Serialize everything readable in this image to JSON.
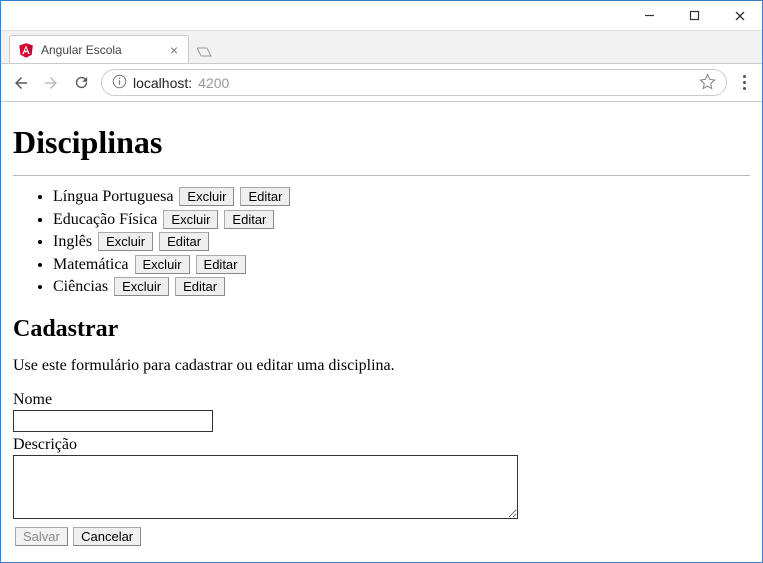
{
  "window": {
    "tab_title": "Angular Escola",
    "url_host": "localhost:",
    "url_port": "4200"
  },
  "page": {
    "heading": "Disciplinas",
    "items": [
      {
        "name": "Língua Portuguesa",
        "delete": "Excluir",
        "edit": "Editar"
      },
      {
        "name": "Educação Física",
        "delete": "Excluir",
        "edit": "Editar"
      },
      {
        "name": "Inglês",
        "delete": "Excluir",
        "edit": "Editar"
      },
      {
        "name": "Matemática",
        "delete": "Excluir",
        "edit": "Editar"
      },
      {
        "name": "Ciências",
        "delete": "Excluir",
        "edit": "Editar"
      }
    ],
    "form": {
      "heading": "Cadastrar",
      "helptext": "Use este formulário para cadastrar ou editar uma disciplina.",
      "name_label": "Nome",
      "name_value": "",
      "desc_label": "Descrição",
      "desc_value": "",
      "save_label": "Salvar",
      "cancel_label": "Cancelar",
      "save_disabled": true
    }
  }
}
